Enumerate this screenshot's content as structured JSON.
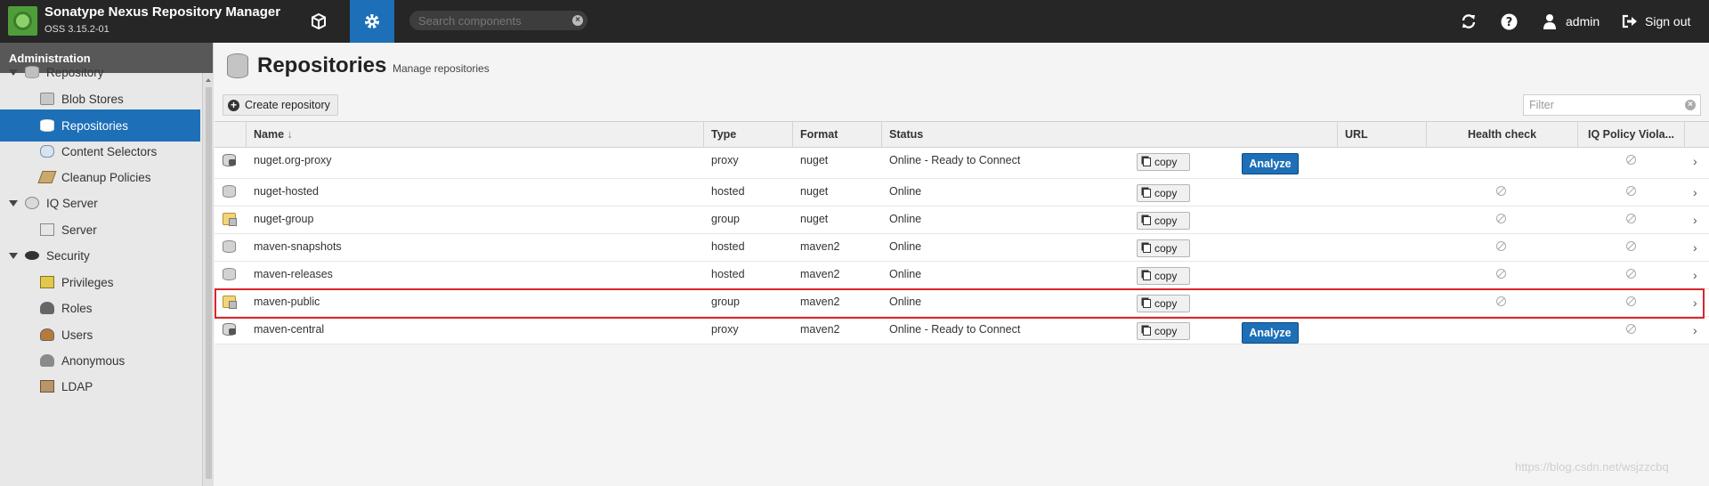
{
  "app": {
    "title": "Sonatype Nexus Repository Manager",
    "version": "OSS 3.15.2-01",
    "search_placeholder": "Search components",
    "user": "admin",
    "signout": "Sign out"
  },
  "sidebar": {
    "header": "Administration",
    "items": [
      {
        "label": "Repository",
        "kind": "section",
        "icon": "database-icon"
      },
      {
        "label": "Blob Stores",
        "kind": "child",
        "icon": "blob-store-icon"
      },
      {
        "label": "Repositories",
        "kind": "child",
        "icon": "database-icon",
        "active": true
      },
      {
        "label": "Content Selectors",
        "kind": "child",
        "icon": "content-selector-icon"
      },
      {
        "label": "Cleanup Policies",
        "kind": "child",
        "icon": "broom-icon"
      },
      {
        "label": "IQ Server",
        "kind": "section",
        "icon": "iq-server-icon"
      },
      {
        "label": "Server",
        "kind": "child",
        "icon": "server-icon"
      },
      {
        "label": "Security",
        "kind": "section",
        "icon": "eye-icon"
      },
      {
        "label": "Privileges",
        "kind": "child",
        "icon": "privilege-icon"
      },
      {
        "label": "Roles",
        "kind": "child",
        "icon": "role-icon"
      },
      {
        "label": "Users",
        "kind": "child",
        "icon": "users-icon"
      },
      {
        "label": "Anonymous",
        "kind": "child",
        "icon": "anonymous-icon"
      },
      {
        "label": "LDAP",
        "kind": "child",
        "icon": "ldap-icon"
      }
    ]
  },
  "page": {
    "title": "Repositories",
    "subtitle": "Manage repositories",
    "create_label": "Create repository",
    "filter_placeholder": "Filter"
  },
  "table": {
    "columns": [
      "Name",
      "Type",
      "Format",
      "Status",
      "URL",
      "Health check",
      "IQ Policy Viola..."
    ],
    "sort_indicator": "↓",
    "copy_label": "copy",
    "analyze_label": "Analyze",
    "rows": [
      {
        "name": "nuget.org-proxy",
        "type": "proxy",
        "format": "nuget",
        "status": "Online - Ready to Connect",
        "health": "analyze"
      },
      {
        "name": "nuget-hosted",
        "type": "hosted",
        "format": "nuget",
        "status": "Online",
        "health": "na"
      },
      {
        "name": "nuget-group",
        "type": "group",
        "format": "nuget",
        "status": "Online",
        "health": "na"
      },
      {
        "name": "maven-snapshots",
        "type": "hosted",
        "format": "maven2",
        "status": "Online",
        "health": "na"
      },
      {
        "name": "maven-releases",
        "type": "hosted",
        "format": "maven2",
        "status": "Online",
        "health": "na"
      },
      {
        "name": "maven-public",
        "type": "group",
        "format": "maven2",
        "status": "Online",
        "health": "na",
        "highlighted": true
      },
      {
        "name": "maven-central",
        "type": "proxy",
        "format": "maven2",
        "status": "Online - Ready to Connect",
        "health": "analyze"
      }
    ]
  },
  "watermark": "https://blog.csdn.net/wsjzzcbq"
}
